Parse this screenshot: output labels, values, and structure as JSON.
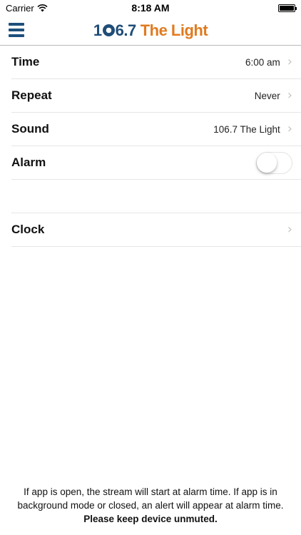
{
  "status_bar": {
    "carrier": "Carrier",
    "time": "8:18 AM",
    "battery_level": 1.0
  },
  "header": {
    "logo_number": "106.7",
    "logo_name": "The Light",
    "logo_colors": {
      "number": "#1f4d77",
      "name": "#e07b1f"
    }
  },
  "settings": {
    "time": {
      "label": "Time",
      "value": "6:00 am"
    },
    "repeat": {
      "label": "Repeat",
      "value": "Never"
    },
    "sound": {
      "label": "Sound",
      "value": "106.7 The Light"
    },
    "alarm": {
      "label": "Alarm",
      "enabled": false
    },
    "clock": {
      "label": "Clock"
    }
  },
  "footer": {
    "note": "If app is open, the stream will start at alarm time. If app is in background mode or closed, an alert will appear at alarm time.",
    "warning": "Please keep device unmuted."
  },
  "icons": [
    "menu-icon",
    "wifi-icon",
    "battery-icon",
    "chevron-right-icon"
  ]
}
